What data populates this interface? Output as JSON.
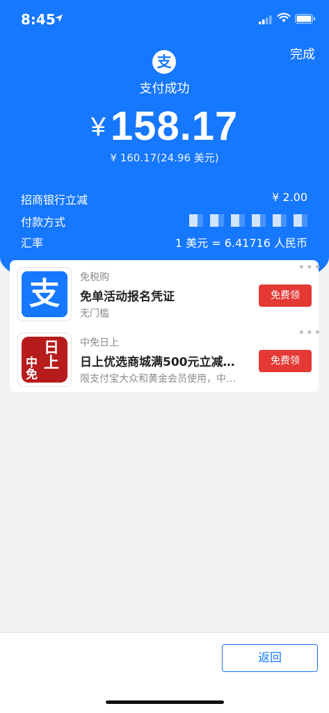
{
  "status_bar": {
    "time": "8:45"
  },
  "header": {
    "done_label": "完成",
    "logo_glyph": "支",
    "title": "支付成功"
  },
  "payment": {
    "currency_symbol": "¥",
    "amount": "158.17",
    "original_amount": "¥ 160.17(24.96 美元)"
  },
  "details": [
    {
      "label": "招商银行立减",
      "value": "¥ 2.00"
    },
    {
      "label": "付款方式",
      "value": ""
    },
    {
      "label": "汇率",
      "value": "1 美元 = 6.41716 人民币"
    }
  ],
  "promos": [
    {
      "icon": "alipay-icon",
      "icon_glyph": "支",
      "brand": "免税购",
      "title": "免单活动报名凭证",
      "desc": "无门槛",
      "button": "免费领"
    },
    {
      "icon": "cdf-seal-icon",
      "icon_top": "日上",
      "icon_bottom": "中免",
      "brand": "中免日上",
      "title": "日上优选商城满500元立减…",
      "desc": "限支付宝大众和黄金会员使用，中…",
      "button": "免费领"
    }
  ],
  "footer": {
    "return_label": "返回"
  },
  "colors": {
    "primary": "#1677ff",
    "button_red": "#e53935",
    "seal_red": "#b71c1c"
  }
}
